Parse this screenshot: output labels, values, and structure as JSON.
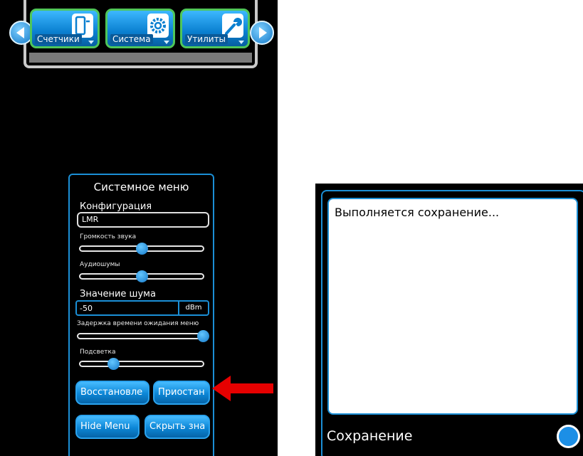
{
  "left_panel": {
    "toolbar": {
      "tiles": [
        {
          "label": "Счетчики",
          "icon": "meter-icon"
        },
        {
          "label": "Система",
          "icon": "gear-icon"
        },
        {
          "label": "Утилиты",
          "icon": "wrench-icon"
        }
      ]
    },
    "system_menu": {
      "title": "Системное меню",
      "config_label": "Конфигурация",
      "config_value": "LMR",
      "volume_label": "Громкость звука",
      "volume_level": 0.5,
      "audio_noise_label": "Аудиошумы",
      "audio_noise_level": 0.5,
      "noise_value_label": "Значение шума",
      "noise_value": "-50",
      "noise_unit": "dBm",
      "menu_timeout_label": "Задержка времени ожидания меню",
      "menu_timeout_level": 1.0,
      "backlight_label": "Подсветка",
      "backlight_level": 0.27,
      "buttons": {
        "restore": "Восстановле",
        "pause": "Приостан",
        "hide_menu": "Hide Menu",
        "hide_menu_ru": "Скрыть зна"
      }
    }
  },
  "dialog": {
    "message": "Выполняется сохранение...",
    "status_label": "Сохранение"
  },
  "colors": {
    "accent_blue": "#1b8fd6",
    "button_blue": "#0c86d6",
    "tile_border_green": "#4fc65a",
    "arrow_red": "#e60000"
  }
}
